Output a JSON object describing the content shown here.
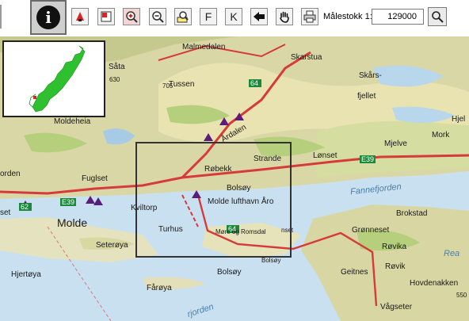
{
  "toolbar": {
    "buttons": [
      {
        "name": "info-button",
        "icon": "info-icon"
      },
      {
        "name": "pointer-tool-button",
        "icon": "red-pointer-icon"
      },
      {
        "name": "select-area-button",
        "icon": "red-box-icon"
      },
      {
        "name": "zoom-in-button",
        "icon": "magnifier-plus-icon"
      },
      {
        "name": "zoom-out-button",
        "icon": "magnifier-minus-icon"
      },
      {
        "name": "zoom-extent-button",
        "icon": "magnifier-page-icon"
      },
      {
        "name": "f-button",
        "label": "F"
      },
      {
        "name": "k-button",
        "label": "K"
      },
      {
        "name": "back-button",
        "icon": "arrow-left-icon"
      },
      {
        "name": "pan-button",
        "icon": "hand-icon"
      },
      {
        "name": "print-button",
        "icon": "printer-icon"
      }
    ],
    "f_label": "F",
    "k_label": "K",
    "scale_label": "Målestokk 1:",
    "scale_value": "129000"
  },
  "map": {
    "labels": {
      "malmedalen": "Malmedalen",
      "saata": "Såta",
      "n630": "630",
      "n705": "705",
      "skarstua": "Skarstua",
      "skars": "Skårs-",
      "fjellet": "fjellet",
      "tussen": "Tussen",
      "moldeheia": "Moldeheia",
      "aandalen": "Årdalen",
      "hjel": "Hjel",
      "mork": "Mork",
      "mjelve": "Mjelve",
      "orden": "orden",
      "fuglset": "Fuglset",
      "robekk": "Røbekk",
      "strande": "Strande",
      "lonset": "Lønset",
      "bolsoy1": "Bolsøy",
      "fannefjorden": "Fannefjorden",
      "set": "set",
      "kviltorp": "Kviltorp",
      "airport": "Molde lufthavn Åro",
      "brokstad": "Brokstad",
      "molde": "Molde",
      "turhus": "Turhus",
      "more_romsdal": "Møre og Romsdal",
      "nset": "nset",
      "gronneset": "Grønneset",
      "setersoy": "Seterøya",
      "bolsoy2": "Bolsøy",
      "rovika": "Røvika",
      "rovik": "Røvik",
      "hjertoya": "Hjertøya",
      "geitnes": "Geitnes",
      "hovdenakken": "Hovdenakken",
      "faroya": "Fårøya",
      "vagseter": "Vågseter",
      "bolsoy3": "Bolsøy",
      "rjorden": "rjorden",
      "rea": "Rea",
      "n550": "550"
    },
    "roads": {
      "e39": "E39",
      "r64": "64",
      "r62": "62"
    }
  }
}
